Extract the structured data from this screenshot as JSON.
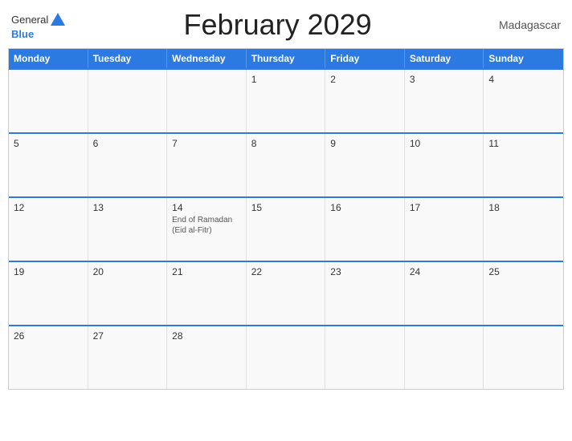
{
  "header": {
    "title": "February 2029",
    "country": "Madagascar",
    "logo": {
      "line1": "General",
      "line2": "Blue"
    }
  },
  "weekdays": [
    "Monday",
    "Tuesday",
    "Wednesday",
    "Thursday",
    "Friday",
    "Saturday",
    "Sunday"
  ],
  "weeks": [
    [
      {
        "day": "",
        "empty": true
      },
      {
        "day": "",
        "empty": true
      },
      {
        "day": "",
        "empty": true
      },
      {
        "day": "1",
        "empty": false,
        "events": []
      },
      {
        "day": "2",
        "empty": false,
        "events": []
      },
      {
        "day": "3",
        "empty": false,
        "events": []
      },
      {
        "day": "4",
        "empty": false,
        "events": []
      }
    ],
    [
      {
        "day": "5",
        "empty": false,
        "events": []
      },
      {
        "day": "6",
        "empty": false,
        "events": []
      },
      {
        "day": "7",
        "empty": false,
        "events": []
      },
      {
        "day": "8",
        "empty": false,
        "events": []
      },
      {
        "day": "9",
        "empty": false,
        "events": []
      },
      {
        "day": "10",
        "empty": false,
        "events": []
      },
      {
        "day": "11",
        "empty": false,
        "events": []
      }
    ],
    [
      {
        "day": "12",
        "empty": false,
        "events": []
      },
      {
        "day": "13",
        "empty": false,
        "events": []
      },
      {
        "day": "14",
        "empty": false,
        "events": [
          "End of Ramadan (Eid al-Fitr)"
        ]
      },
      {
        "day": "15",
        "empty": false,
        "events": []
      },
      {
        "day": "16",
        "empty": false,
        "events": []
      },
      {
        "day": "17",
        "empty": false,
        "events": []
      },
      {
        "day": "18",
        "empty": false,
        "events": []
      }
    ],
    [
      {
        "day": "19",
        "empty": false,
        "events": []
      },
      {
        "day": "20",
        "empty": false,
        "events": []
      },
      {
        "day": "21",
        "empty": false,
        "events": []
      },
      {
        "day": "22",
        "empty": false,
        "events": []
      },
      {
        "day": "23",
        "empty": false,
        "events": []
      },
      {
        "day": "24",
        "empty": false,
        "events": []
      },
      {
        "day": "25",
        "empty": false,
        "events": []
      }
    ],
    [
      {
        "day": "26",
        "empty": false,
        "events": []
      },
      {
        "day": "27",
        "empty": false,
        "events": []
      },
      {
        "day": "28",
        "empty": false,
        "events": []
      },
      {
        "day": "",
        "empty": true
      },
      {
        "day": "",
        "empty": true
      },
      {
        "day": "",
        "empty": true
      },
      {
        "day": "",
        "empty": true
      }
    ]
  ],
  "colors": {
    "header_bg": "#2a7ae2",
    "accent": "#2a7ae2"
  }
}
